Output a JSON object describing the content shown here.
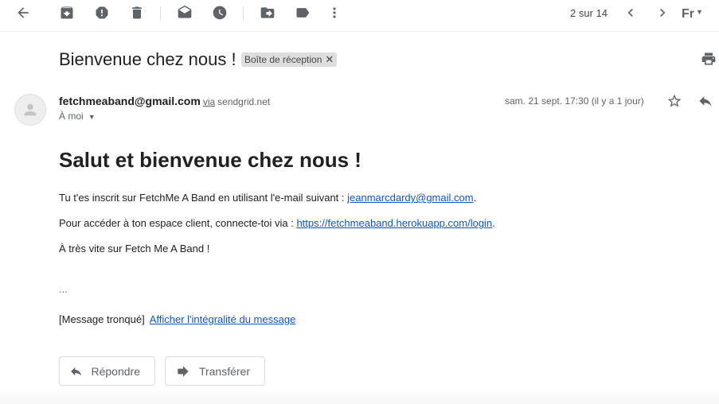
{
  "toolbar": {
    "icons": [
      "back-arrow-icon",
      "archive-icon",
      "report-spam-icon",
      "delete-icon",
      "mark-unread-icon",
      "snooze-icon",
      "move-to-icon",
      "label-icon",
      "more-vert-icon"
    ],
    "pager": "2 sur 14",
    "lang": "Fr"
  },
  "email": {
    "subject": "Bienvenue chez nous !",
    "label": "Boîte de réception",
    "sender": "fetchmeaband@gmail.com",
    "via_label": "via",
    "via_domain": "sendgrid.net",
    "to": "À moi",
    "date": "sam. 21 sept. 17:30 (il y a 1 jour)"
  },
  "body": {
    "heading": "Salut et bienvenue chez nous !",
    "p1_text": "Tu t'es inscrit sur FetchMe A Band en utilisant l'e-mail suivant : ",
    "p1_link": "jeanmarcdardy@gmail.com",
    "p1_end": ".",
    "p2_text": "Pour accéder à ton espace client, connecte-toi via : ",
    "p2_link": "https://fetchmeaband.herokuapp.com/login",
    "p2_end": ".",
    "p3_text": "À très vite sur Fetch Me A Band !",
    "ellipsis": "...",
    "truncated": "[Message tronqué]",
    "show_full": "Afficher l'intégralité du message"
  },
  "actions": {
    "reply": "Répondre",
    "forward": "Transférer"
  },
  "colors": {
    "link": "#1155cc",
    "icon": "#5f6368"
  }
}
